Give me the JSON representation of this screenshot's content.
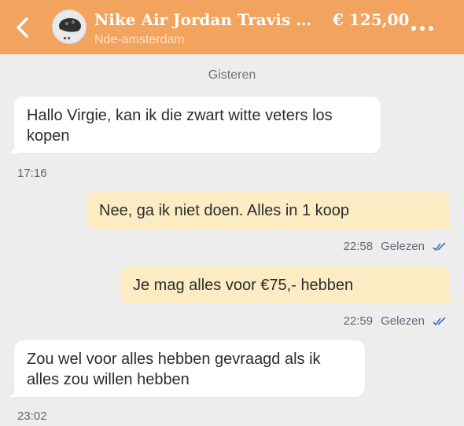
{
  "header": {
    "title": "Nike Air Jordan Travis Scott...",
    "price": "€ 125,00",
    "subtitle": "Nde-amsterdam",
    "back_icon": "chevron-left-icon",
    "menu_icon": "more-dots-icon"
  },
  "day_label": "Gisteren",
  "messages": [
    {
      "direction": "in",
      "text": "Hallo Virgie, kan ik die zwart witte veters los kopen",
      "time": "17:16",
      "status": ""
    },
    {
      "direction": "out",
      "text": "Nee, ga ik niet doen. Alles in 1 koop",
      "time": "22:58",
      "status": "Gelezen"
    },
    {
      "direction": "out",
      "text": "Je mag alles voor €75,- hebben",
      "time": "22:59",
      "status": "Gelezen"
    },
    {
      "direction": "in",
      "text": "Zou wel voor alles hebben gevraagd als ik alles zou willen hebben",
      "time": "23:02",
      "status": ""
    }
  ],
  "colors": {
    "header": "#f2a35e",
    "background": "#ededed",
    "outgoing_bubble": "#fbecc4",
    "incoming_bubble": "#ffffff",
    "read_tick": "#3f6fb5"
  }
}
